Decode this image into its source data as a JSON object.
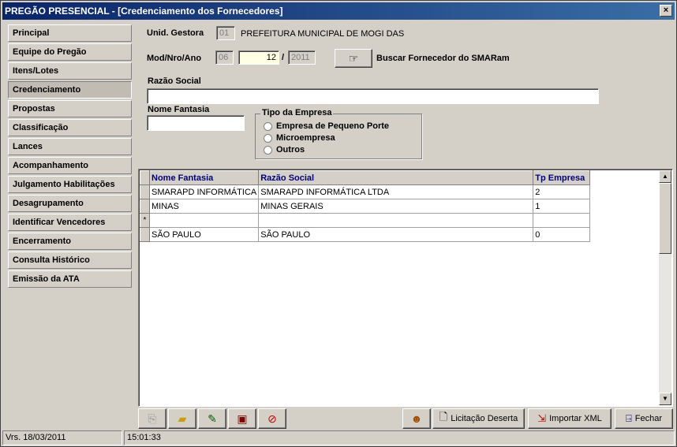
{
  "window": {
    "title": "PREGÃO PRESENCIAL - [Credenciamento dos Fornecedores]",
    "close_label": "×"
  },
  "sidebar": {
    "items": [
      {
        "label": "Principal"
      },
      {
        "label": "Equipe do Pregão"
      },
      {
        "label": "Itens/Lotes"
      },
      {
        "label": "Credenciamento"
      },
      {
        "label": "Propostas"
      },
      {
        "label": "Classificação"
      },
      {
        "label": "Lances"
      },
      {
        "label": "Acompanhamento"
      },
      {
        "label": "Julgamento Habilitações"
      },
      {
        "label": "Desagrupamento"
      },
      {
        "label": "Identificar Vencedores"
      },
      {
        "label": "Encerramento"
      },
      {
        "label": "Consulta Histórico"
      },
      {
        "label": "Emissão da ATA"
      }
    ],
    "active": "Credenciamento"
  },
  "form": {
    "unid_label": "Unid. Gestora",
    "unid_code": "01",
    "unid_name": "PREFEITURA MUNICIPAL DE MOGI DAS",
    "mod_label": "Mod/Nro/Ano",
    "mod_value": "06",
    "nro_value": "12",
    "ano_value": "2011",
    "slash": "/",
    "buscar_label": "Buscar Fornecedor do SMARam",
    "razao_label": "Razão Social",
    "razao_value": "",
    "fantasia_label": "Nome Fantasia",
    "fantasia_value": "",
    "tipo_title": "Tipo da Empresa",
    "tipo_options": [
      "Empresa de Pequeno Porte",
      "Microempresa",
      "Outros"
    ]
  },
  "grid": {
    "columns": [
      "Nome Fantasia",
      "Razão Social",
      "Tp Empresa"
    ],
    "rows": [
      {
        "indicator": "",
        "fantasia": "SMARAPD INFORMÁTICA",
        "razao": "SMARAPD INFORMÁTICA LTDA",
        "tp": "2"
      },
      {
        "indicator": "",
        "fantasia": "MINAS",
        "razao": "MINAS GERAIS",
        "tp": "1"
      },
      {
        "indicator": "*",
        "fantasia": "",
        "razao": "",
        "tp": ""
      },
      {
        "indicator": "",
        "fantasia": "SÃO PAULO",
        "razao": "SÃO PAULO",
        "tp": "0"
      }
    ]
  },
  "toolbar": {
    "licitacao_label": "Licitação Deserta",
    "importar_label": "Importar XML",
    "fechar_label": "Fechar"
  },
  "status": {
    "version": "Vrs. 18/03/2011",
    "time": "15:01:33"
  }
}
